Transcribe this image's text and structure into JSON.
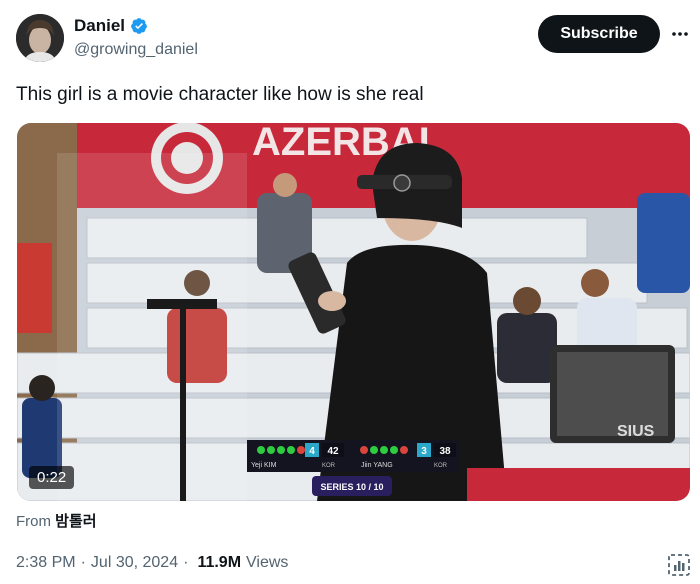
{
  "author": {
    "display_name": "Daniel",
    "handle": "@growing_daniel",
    "verified": true
  },
  "header": {
    "subscribe_label": "Subscribe",
    "more_icon": "more-horizontal-icon"
  },
  "tweet": {
    "text": "This girl is a movie character like how is she real"
  },
  "media": {
    "duration": "0:22",
    "banner_text": "AZERBAI",
    "scoreboard": {
      "left_player": "Yeji KIM",
      "left_country": "KOR",
      "left_series_score": "4",
      "left_total": "42",
      "right_player": "Jiin YANG",
      "right_country": "KOR",
      "right_series_score": "3",
      "right_total": "38",
      "series_label": "SERIES 10 / 10"
    },
    "monitor_brand": "SIUS"
  },
  "source": {
    "prefix": "From",
    "name": "밤톨러"
  },
  "meta": {
    "time": "2:38 PM",
    "date": "Jul 30, 2024",
    "views_count": "11.9M",
    "views_label": "Views"
  },
  "colors": {
    "accent_blue": "#1d9bf0",
    "text_primary": "#0f1419",
    "text_secondary": "#536471"
  }
}
